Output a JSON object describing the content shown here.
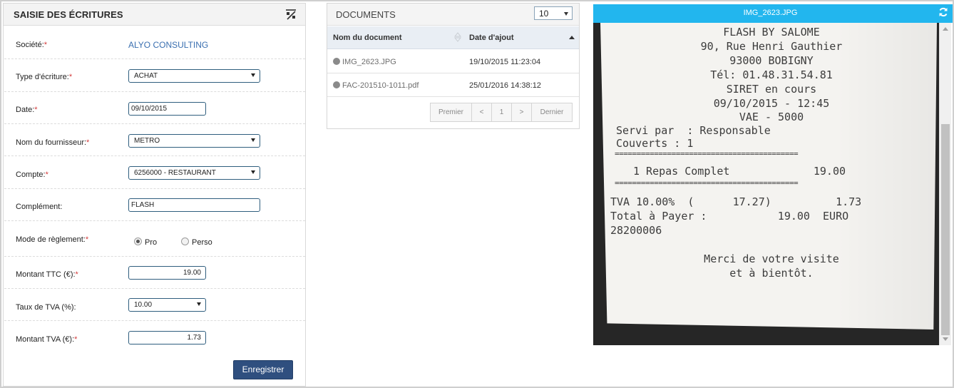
{
  "form": {
    "title": "SAISIE DES ÉCRITURES",
    "required_mark": "*",
    "fields": {
      "societe": {
        "label": "Société:",
        "value": "ALYO CONSULTING"
      },
      "type_ecriture": {
        "label": "Type d'écriture:",
        "value": "ACHAT"
      },
      "date": {
        "label": "Date:",
        "value": "09/10/2015"
      },
      "fournisseur": {
        "label": "Nom du fournisseur:",
        "value": "METRO"
      },
      "compte": {
        "label": "Compte:",
        "value": "6256000 - RESTAURANT"
      },
      "complement": {
        "label": "Complément:",
        "value": "FLASH"
      },
      "reglement": {
        "label": "Mode de règlement:",
        "options": [
          "Pro",
          "Perso"
        ],
        "selected": "Pro"
      },
      "montant_ttc": {
        "label": "Montant TTC (€):",
        "value": "19.00"
      },
      "taux_tva": {
        "label": "Taux de TVA (%):",
        "value": "10.00"
      },
      "montant_tva": {
        "label": "Montant TVA (€):",
        "value": "1.73"
      }
    },
    "save_label": "Enregistrer"
  },
  "documents": {
    "title": "DOCUMENTS",
    "page_size": "10",
    "columns": [
      "Nom du document",
      "Date d'ajout"
    ],
    "rows": [
      {
        "name": "IMG_2623.JPG",
        "date": "19/10/2015 11:23:04"
      },
      {
        "name": "FAC-201510-1011.pdf",
        "date": "25/01/2016 14:38:12"
      }
    ],
    "pager": {
      "first": "Premier",
      "prev": "<",
      "page": "1",
      "next": ">",
      "last": "Dernier"
    }
  },
  "viewer": {
    "filename": "IMG_2623.JPG",
    "accent": "#22b6ee",
    "receipt": {
      "l1": "FLASH BY SALOME",
      "l2": "90, Rue Henri Gauthier",
      "l3": "93000 BOBIGNY",
      "l4": "Tél: 01.48.31.54.81",
      "l5": "SIRET en cours",
      "l6": "09/10/2015 - 12:45",
      "l7": "VAE - 5000",
      "l8": "Servi par  : Responsable",
      "l9": "Couverts : 1",
      "sep": "==========================================",
      "l10": "1 Repas Complet             19.00",
      "l11": "TVA 10.00%  (      17.27)          1.73",
      "l12": "Total à Payer :           19.00  EURO",
      "l13": "28200006",
      "l14": "Merci de votre visite",
      "l15": "et à bientôt."
    }
  }
}
